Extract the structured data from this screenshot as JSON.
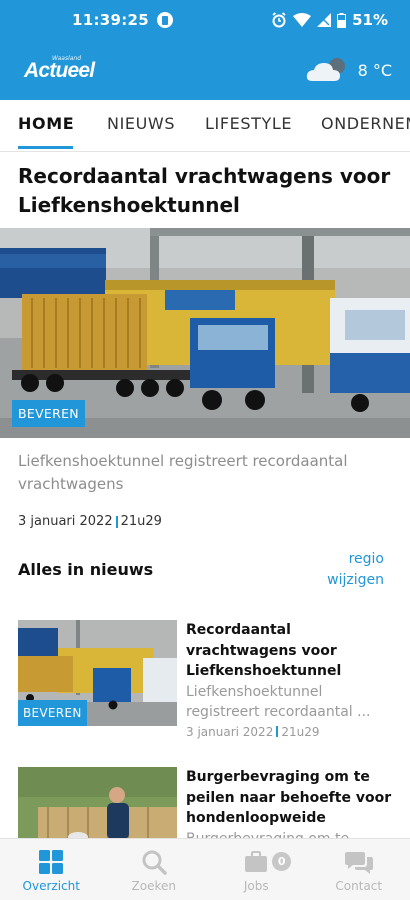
{
  "status_bar": {
    "time": "11:39:25",
    "battery": "51%"
  },
  "header": {
    "logo_small": "Waasland",
    "logo_main": "Actueel",
    "weather_icon": "cloud-icon",
    "temperature": "8 °C"
  },
  "tabs": [
    {
      "label": "HOME",
      "active": true
    },
    {
      "label": "NIEUWS",
      "active": false
    },
    {
      "label": "LIFESTYLE",
      "active": false
    },
    {
      "label": "ONDERNEMEN",
      "active": false
    }
  ],
  "featured": {
    "title": "Recordaantal vrachtwagens voor Liefkenshoektunnel",
    "badge": "BEVEREN",
    "subtitle": "Liefkenshoektunnel registreert recordaantal vrachtwagens",
    "date": "3 januari 2022",
    "time": "21u29"
  },
  "section": {
    "title": "Alles in nieuws",
    "region_link_line1": "regio",
    "region_link_line2": "wijzigen"
  },
  "list_items": [
    {
      "title": "Recordaantal vrachtwagens voor Liefkenshoektunnel",
      "snippet_line1": "Liefkenshoektunnel",
      "snippet_line2": "registreert recordaantal ...",
      "date": "3 januari 2022",
      "time": "21u29",
      "badge": "BEVEREN"
    },
    {
      "title": "Burgerbevraging om te peilen naar behoefte voor hondenloopweide",
      "snippet_line1": "Burgerbevraging om te"
    }
  ],
  "bottom_nav": [
    {
      "label": "Overzicht",
      "icon": "grid-icon",
      "active": true
    },
    {
      "label": "Zoeken",
      "icon": "search-icon",
      "active": false
    },
    {
      "label": "Jobs",
      "icon": "briefcase-icon",
      "active": false,
      "count": "0"
    },
    {
      "label": "Contact",
      "icon": "chat-icon",
      "active": false
    }
  ],
  "colors": {
    "brand_blue": "#2196d9",
    "muted_text": "#8d8d8d"
  }
}
